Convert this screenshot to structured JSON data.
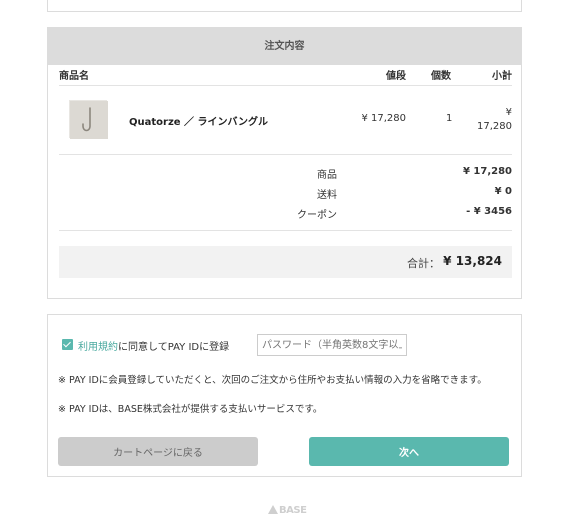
{
  "order": {
    "title": "注文内容",
    "columns": {
      "product": "商品名",
      "price": "値段",
      "qty": "個数",
      "subtotal": "小計"
    },
    "item": {
      "name": "Quatorze ／ ラインバングル",
      "price": "¥ 17,280",
      "qty": "1",
      "subtotal_symbol": "¥",
      "subtotal_amount": "17,280"
    },
    "summary": {
      "goods_label": "商品",
      "goods_value": "¥ 17,280",
      "shipping_label": "送料",
      "shipping_value": "¥ 0",
      "coupon_label": "クーポン",
      "coupon_value": "- ¥ 3456"
    },
    "total": {
      "label": "合計：",
      "value": "¥ 13,824"
    }
  },
  "register": {
    "terms_link": "利用規約",
    "agree_text": "に同意してPAY IDに登録",
    "checked": true,
    "password_placeholder": "パスワード（半角英数8文字以上）",
    "note1": "※ PAY IDに会員登録していただくと、次回のご注文から住所やお支払い情報の入力を省略できます。",
    "note2": "※ PAY IDは、BASE株式会社が提供する支払いサービスです。",
    "back_label": "カートページに戻る",
    "next_label": "次へ"
  },
  "footer": {
    "logo_text": "BASE"
  },
  "colors": {
    "accent": "#5ab8ae",
    "header_bg": "#dcdcdc",
    "button_grey": "#cccccc"
  }
}
